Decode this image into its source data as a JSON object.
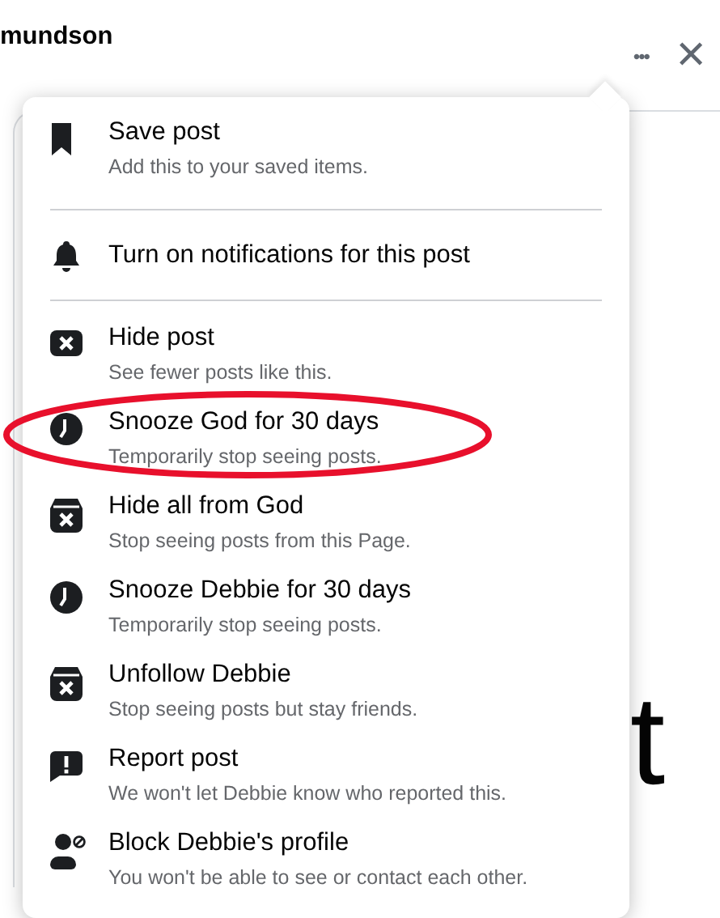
{
  "header": {
    "name": "mundson",
    "more_button": "•••",
    "close_button": "✕"
  },
  "post": {
    "rows": [
      {
        "right": ""
      },
      {
        "right": ""
      },
      {
        "right": "t"
      }
    ]
  },
  "menu": {
    "groups": [
      {
        "items": [
          {
            "title": "Save post",
            "subtitle": "Add this to your saved items."
          }
        ]
      },
      {
        "items": [
          {
            "title": "Turn on notifications for this post"
          }
        ]
      },
      {
        "items": [
          {
            "title": "Hide post",
            "subtitle": "See fewer posts like this."
          },
          {
            "title": "Snooze God for 30 days",
            "subtitle": "Temporarily stop seeing posts."
          },
          {
            "title": "Hide all from God",
            "subtitle": "Stop seeing posts from this Page."
          },
          {
            "title": "Snooze Debbie for 30 days",
            "subtitle": "Temporarily stop seeing posts."
          },
          {
            "title": "Unfollow Debbie",
            "subtitle": "Stop seeing posts but stay friends."
          },
          {
            "title": "Report post",
            "subtitle": "We won't let Debbie know who reported this."
          },
          {
            "title": "Block Debbie's profile",
            "subtitle": "You won't be able to see or contact each other."
          }
        ]
      }
    ]
  },
  "annotation": {
    "kind": "ellipse",
    "color": "#e8102c"
  }
}
